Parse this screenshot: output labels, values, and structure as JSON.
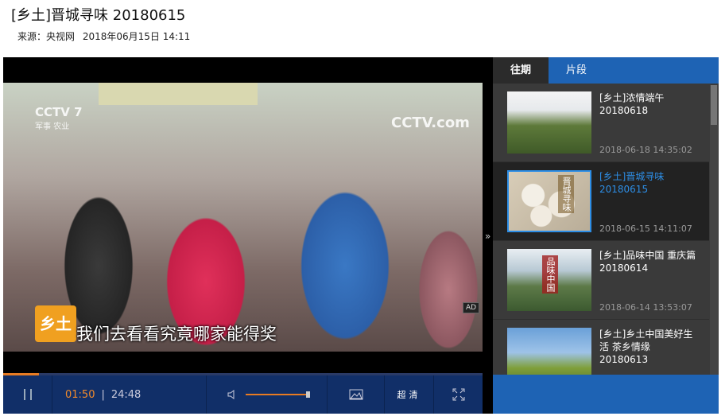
{
  "header": {
    "title": "[乡土]晋城寻味 20180615",
    "source_label": "来源：央视网",
    "publish_time": "2018年06月15日 14:11"
  },
  "player": {
    "watermark_left": "CCTV 7",
    "watermark_left_sub": "军事 农业",
    "watermark_right": "CCTV.com",
    "show_logo": "乡土",
    "subtitle": "我们去看看究竟哪家能得奖",
    "ad_badge": "AD",
    "expand_glyph": "»",
    "progress_fraction": 0.074,
    "volume_fraction": 1.0,
    "current_time": "01:50",
    "time_separator": "|",
    "total_time": "24:48",
    "quality_label": "超清"
  },
  "sidebar": {
    "tabs": [
      {
        "label": "往期",
        "active": true
      },
      {
        "label": "片段",
        "active": false
      }
    ],
    "items": [
      {
        "title": "[乡土]浓情端午 20180618",
        "date": "2018-06-18 14:35:02",
        "thumb_tag": "",
        "active": false
      },
      {
        "title": "[乡土]晋城寻味 20180615",
        "date": "2018-06-15 14:11:07",
        "thumb_tag": "晋城寻味",
        "active": true
      },
      {
        "title": "[乡土]品味中国 重庆篇 20180614",
        "date": "2018-06-14 13:53:07",
        "thumb_tag": "品味中国",
        "active": false
      },
      {
        "title": "[乡土]乡土中国美好生活 茶乡情缘 20180613",
        "date": "",
        "thumb_tag": "",
        "active": false
      }
    ]
  },
  "colors": {
    "accent_blue": "#1e63b4",
    "progress_orange": "#e87b22",
    "control_bar": "#112f68",
    "active_item_text": "#2d8ee6"
  }
}
